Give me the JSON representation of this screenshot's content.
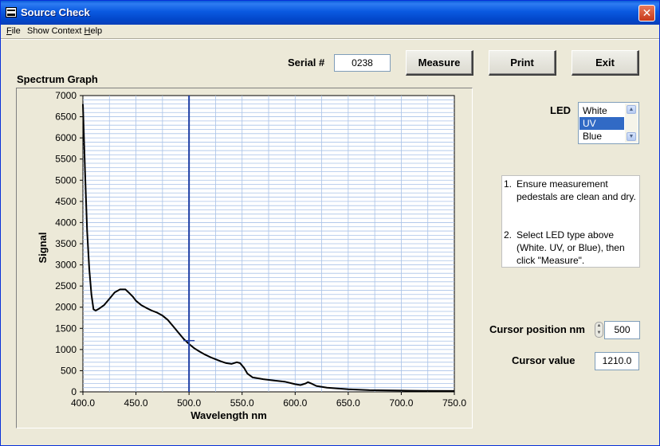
{
  "window": {
    "title": "Source Check",
    "close_glyph": "✕"
  },
  "menu": {
    "file": "F",
    "file_rest": "ile",
    "context_prefix": "Show Context ",
    "context_h": "H",
    "context_rest": "elp"
  },
  "serial": {
    "label": "Serial #",
    "value": "0238"
  },
  "buttons": {
    "measure": "Measure",
    "print": "Print",
    "exit": "Exit"
  },
  "graph": {
    "title": "Spectrum Graph"
  },
  "led": {
    "label": "LED",
    "options": [
      "White",
      "UV",
      "Blue"
    ],
    "selected": "UV"
  },
  "instructions": [
    {
      "num": "1.",
      "text": "Ensure measurement pedestals are clean and dry."
    },
    {
      "num": "2.",
      "text": "Select LED type above (White. UV, or Blue), then click \"Measure\"."
    }
  ],
  "cursor": {
    "position_label": "Cursor position nm",
    "position_value": "500",
    "value_label": "Cursor  value",
    "value": "1210.0"
  },
  "icons": {
    "app": "app-icon",
    "close": "close-icon",
    "spinner": "spin-updown-icon"
  },
  "colors": {
    "cursor_line": "#1f3fa6",
    "grid": "#a9c2e8",
    "trace": "#000000",
    "titlebar": "#0a59e0"
  },
  "chart_data": {
    "type": "line",
    "title": "Spectrum Graph",
    "xlabel": "Wavelength nm",
    "ylabel": "Signal",
    "xlim": [
      400,
      750
    ],
    "ylim": [
      0,
      7000
    ],
    "x_ticks": [
      "400.0",
      "450.0",
      "500.0",
      "550.0",
      "600.0",
      "650.0",
      "700.0",
      "750.0"
    ],
    "y_ticks": [
      "0",
      "500",
      "1000",
      "1500",
      "2000",
      "2500",
      "3000",
      "3500",
      "4000",
      "4500",
      "5000",
      "5500",
      "6000",
      "6500",
      "7000"
    ],
    "grid": true,
    "cursor_x": 500,
    "cursor_y": 1210,
    "series": [
      {
        "x": [
          400,
          402,
          404,
          406,
          408,
          410,
          412,
          415,
          420,
          425,
          430,
          435,
          440,
          443,
          447,
          450,
          455,
          460,
          465,
          470,
          475,
          480,
          485,
          490,
          495,
          500,
          505,
          510,
          515,
          520,
          525,
          530,
          535,
          540,
          545,
          548,
          552,
          555,
          560,
          570,
          580,
          590,
          600,
          605,
          610,
          612,
          615,
          620,
          630,
          640,
          650,
          670,
          700,
          720,
          750
        ],
        "y": [
          6800,
          5200,
          3800,
          2900,
          2300,
          1950,
          1920,
          1960,
          2050,
          2200,
          2350,
          2420,
          2420,
          2350,
          2250,
          2150,
          2050,
          1980,
          1920,
          1870,
          1800,
          1700,
          1550,
          1400,
          1250,
          1130,
          1030,
          950,
          880,
          820,
          770,
          720,
          680,
          660,
          700,
          680,
          560,
          430,
          340,
          300,
          270,
          240,
          180,
          160,
          200,
          230,
          200,
          140,
          100,
          80,
          60,
          40,
          30,
          25,
          20
        ]
      }
    ]
  }
}
